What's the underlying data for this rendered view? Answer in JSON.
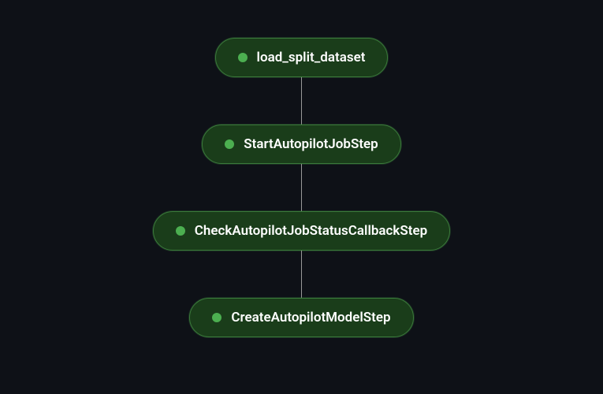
{
  "pipeline": {
    "nodes": [
      {
        "label": "load_split_dataset",
        "status": "success"
      },
      {
        "label": "StartAutopilotJobStep",
        "status": "success"
      },
      {
        "label": "CheckAutopilotJobStatusCallbackStep",
        "status": "success"
      },
      {
        "label": "CreateAutopilotModelStep",
        "status": "success"
      }
    ]
  },
  "colors": {
    "background": "#0e1117",
    "nodeBackground": "#1a3d1a",
    "nodeBorder": "#3a7a3a",
    "statusSuccess": "#4caf50",
    "connector": "#999999",
    "text": "#ffffff"
  }
}
